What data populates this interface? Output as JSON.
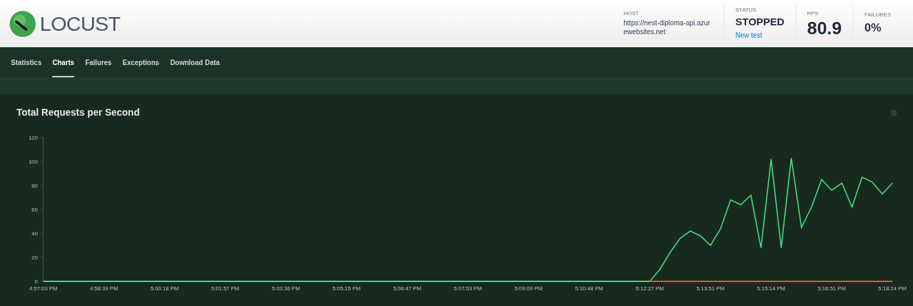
{
  "header": {
    "logo_text": "LOCUST",
    "stats": [
      {
        "kind": "host",
        "label": "HOST",
        "value": "https://nest-diploma-api.azurewebsites.net"
      },
      {
        "kind": "status",
        "label": "STATUS",
        "value": "STOPPED",
        "link": "New test"
      },
      {
        "kind": "big",
        "label": "RPS",
        "value": "80.9"
      },
      {
        "kind": "medium",
        "label": "FAILURES",
        "value": "0%"
      }
    ]
  },
  "tabs": [
    {
      "label": "Statistics",
      "selected": false
    },
    {
      "label": "Charts",
      "selected": true
    },
    {
      "label": "Failures",
      "selected": false
    },
    {
      "label": "Exceptions",
      "selected": false
    },
    {
      "label": "Download Data",
      "selected": false
    }
  ],
  "chart": {
    "title": "Total Requests per Second",
    "chart_data": {
      "type": "line",
      "ylim": [
        0,
        120
      ],
      "yticks": [
        0,
        20,
        40,
        60,
        80,
        100,
        120
      ],
      "categories": [
        "4:57:03 PM",
        null,
        null,
        null,
        null,
        null,
        "4:58:39 PM",
        null,
        null,
        null,
        null,
        null,
        "5:00:18 PM",
        null,
        null,
        null,
        null,
        null,
        "5:01:57 PM",
        null,
        null,
        null,
        null,
        null,
        "5:03:36 PM",
        null,
        null,
        null,
        null,
        null,
        "5:05:15 PM",
        null,
        null,
        null,
        null,
        null,
        "5:06:47 PM",
        null,
        null,
        null,
        null,
        null,
        "5:07:53 PM",
        null,
        null,
        null,
        null,
        null,
        "5:09:09 PM",
        null,
        null,
        null,
        null,
        null,
        "5:10:48 PM",
        null,
        null,
        null,
        null,
        null,
        "5:12:27 PM",
        null,
        null,
        null,
        null,
        null,
        "5:13:51 PM",
        null,
        null,
        null,
        null,
        null,
        "5:15:14 PM",
        null,
        null,
        null,
        null,
        null,
        "5:16:51 PM",
        null,
        null,
        null,
        null,
        null,
        "5:18:24 PM"
      ],
      "series": [
        {
          "color": "#4ade80",
          "values": [
            0,
            0,
            0,
            0,
            0,
            0,
            0,
            0,
            0,
            0,
            0,
            0,
            0,
            0,
            0,
            0,
            0,
            0,
            0,
            0,
            0,
            0,
            0,
            0,
            0,
            0,
            0,
            0,
            0,
            0,
            0,
            0,
            0,
            0,
            0,
            0,
            0,
            0,
            0,
            0,
            0,
            0,
            0,
            0,
            0,
            0,
            0,
            0,
            0,
            0,
            0,
            0,
            0,
            0,
            0,
            0,
            0,
            0,
            0,
            0,
            0,
            10,
            24,
            36,
            42,
            38,
            30,
            44,
            68,
            64,
            72,
            28,
            102,
            28,
            103,
            45,
            62,
            85,
            76,
            82,
            62,
            87,
            83,
            73,
            82
          ]
        },
        {
          "color": "#e05252",
          "values": [
            null,
            null,
            null,
            null,
            null,
            null,
            null,
            null,
            null,
            null,
            null,
            null,
            null,
            null,
            null,
            null,
            null,
            null,
            null,
            null,
            null,
            null,
            null,
            null,
            null,
            null,
            null,
            null,
            null,
            null,
            null,
            null,
            null,
            null,
            null,
            null,
            null,
            null,
            null,
            null,
            null,
            null,
            null,
            null,
            null,
            null,
            null,
            null,
            null,
            null,
            null,
            null,
            null,
            null,
            null,
            null,
            null,
            null,
            null,
            null,
            0,
            0,
            0,
            0,
            0,
            0,
            0,
            0,
            0,
            0,
            0,
            0,
            0,
            0,
            0,
            0,
            0,
            0,
            0,
            0,
            0,
            0,
            0,
            0,
            0
          ]
        }
      ]
    }
  }
}
